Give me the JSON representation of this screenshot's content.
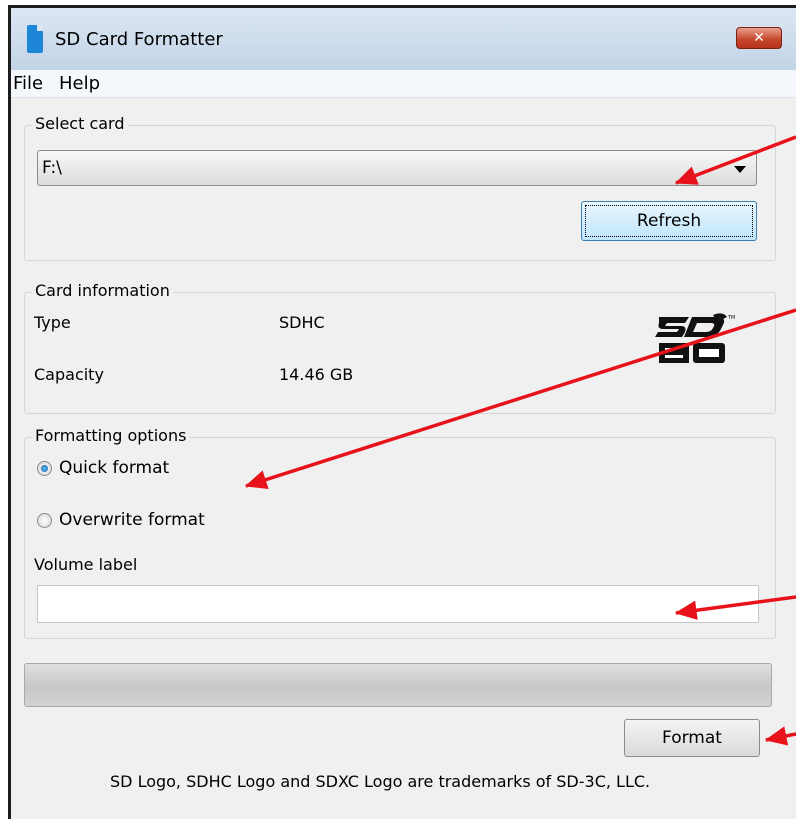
{
  "window": {
    "title": "SD Card Formatter",
    "close_glyph": "✕"
  },
  "menu": {
    "items": [
      "File",
      "Help"
    ]
  },
  "select_card": {
    "group_title": "Select card",
    "selected_drive": "F:\\",
    "refresh_label": "Refresh"
  },
  "card_info": {
    "group_title": "Card information",
    "type_label": "Type",
    "type_value": "SDHC",
    "capacity_label": "Capacity",
    "capacity_value": "14.46 GB",
    "logo": "sdhc-logo"
  },
  "formatting": {
    "group_title": "Formatting options",
    "options": [
      {
        "label": "Quick format",
        "selected": true
      },
      {
        "label": "Overwrite format",
        "selected": false
      }
    ],
    "volume_label": "Volume label",
    "volume_value": ""
  },
  "progress": {
    "value": 0
  },
  "format_button": "Format",
  "footer": "SD Logo, SDHC Logo and SDXC Logo are trademarks of SD-3C, LLC.",
  "annotation_color": "#e8121b"
}
